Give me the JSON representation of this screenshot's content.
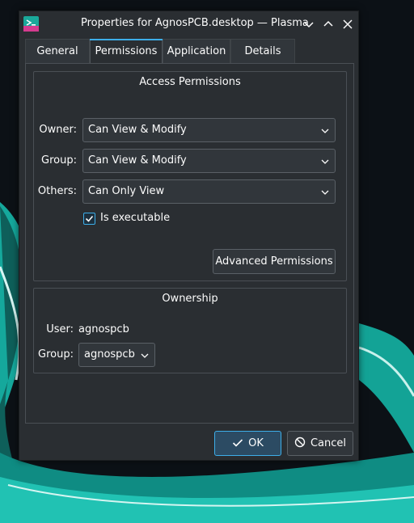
{
  "window": {
    "title": "Properties for AgnosPCB.desktop — Plasma"
  },
  "tabs": [
    {
      "label": "General",
      "active": false
    },
    {
      "label": "Permissions",
      "active": true
    },
    {
      "label": "Application",
      "active": false
    },
    {
      "label": "Details",
      "active": false
    }
  ],
  "access": {
    "title": "Access Permissions",
    "owner_label": "Owner:",
    "owner_value": "Can View & Modify",
    "group_label": "Group:",
    "group_value": "Can View & Modify",
    "others_label": "Others:",
    "others_value": "Can Only View",
    "executable_label": "Is executable",
    "executable_checked": true,
    "advanced_button": "Advanced Permissions"
  },
  "ownership": {
    "title": "Ownership",
    "user_label": "User:",
    "user_value": "agnospcb",
    "group_label": "Group:",
    "group_value": "agnospcb"
  },
  "buttons": {
    "ok": "OK",
    "cancel": "Cancel"
  },
  "colors": {
    "accent": "#3daee9",
    "window_bg": "#2a2e32",
    "wallpaper_teal": "#19b3a6"
  },
  "icons": [
    "application-icon",
    "minimize-icon",
    "maximize-icon",
    "close-icon",
    "chevron-down-icon",
    "checkmark-icon",
    "cancel-icon"
  ]
}
